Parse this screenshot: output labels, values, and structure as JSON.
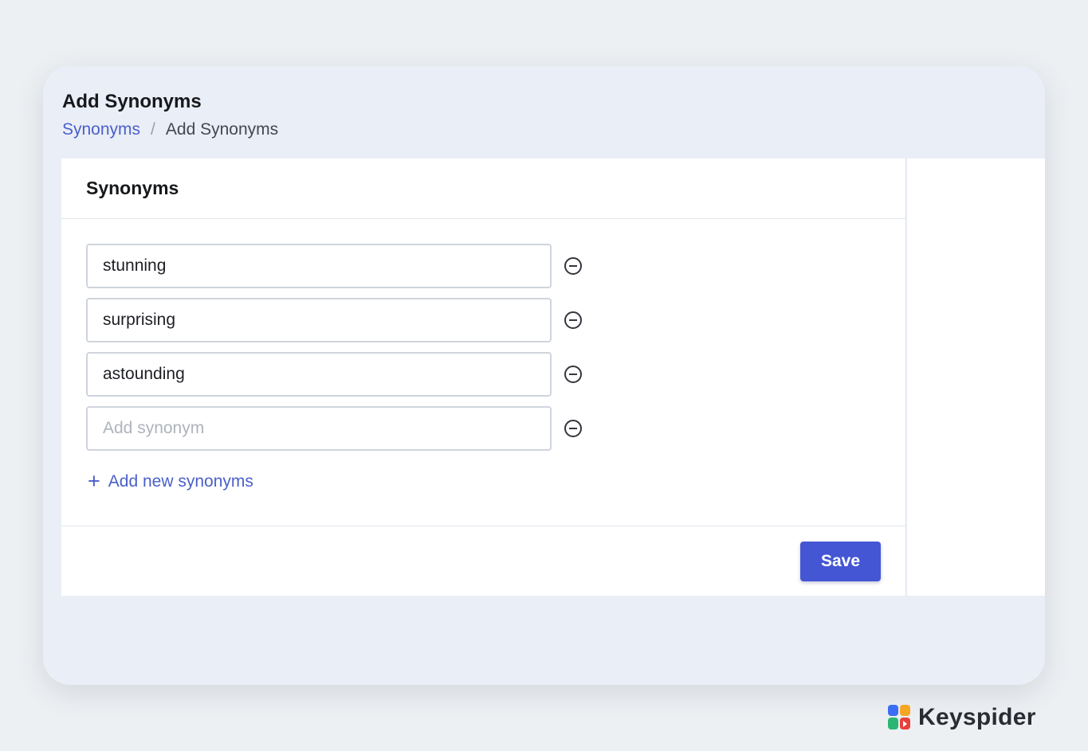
{
  "header": {
    "title": "Add Synonyms",
    "breadcrumb": {
      "link": "Synonyms",
      "separator": "/",
      "current": "Add Synonyms"
    }
  },
  "card": {
    "title": "Synonyms",
    "synonyms": [
      "stunning",
      "surprising",
      "astounding",
      ""
    ],
    "input_placeholder": "Add synonym",
    "add_label": "Add new synonyms",
    "save_label": "Save"
  },
  "brand": {
    "name": "Keyspider",
    "logo_colors": [
      "#3b6ef5",
      "#f5a623",
      "#2bb673",
      "#e8403c"
    ]
  },
  "colors": {
    "accent": "#4456d4",
    "link": "#4a5fc9"
  }
}
